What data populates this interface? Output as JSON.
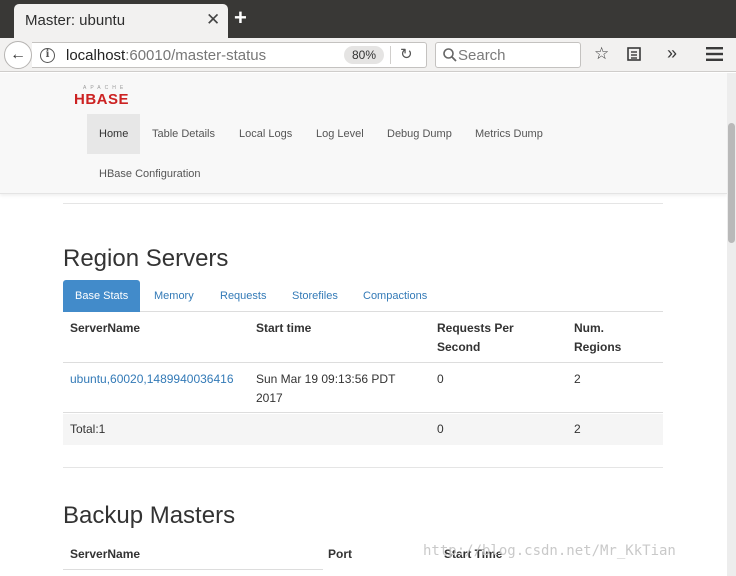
{
  "browser": {
    "tab_title": "Master: ubuntu",
    "tab_close": "✕",
    "new_tab": "+",
    "url_host": "localhost",
    "url_rest": ":60010/master-status",
    "zoom": "80%",
    "search_placeholder": "Search"
  },
  "hbase": {
    "logo_top": "APACHE",
    "logo_main": "HBASE",
    "nav": [
      "Home",
      "Table Details",
      "Local Logs",
      "Log Level",
      "Debug Dump",
      "Metrics Dump",
      "HBase Configuration"
    ]
  },
  "region_servers": {
    "title": "Region Servers",
    "tabs": [
      "Base Stats",
      "Memory",
      "Requests",
      "Storefiles",
      "Compactions"
    ],
    "headers": [
      "ServerName",
      "Start time",
      "Requests Per Second",
      "Num. Regions"
    ],
    "rows": [
      [
        "ubuntu,60020,1489940036416",
        "Sun Mar 19 09:13:56 PDT 2017",
        "0",
        "2"
      ]
    ],
    "total": [
      "Total:1",
      "",
      "0",
      "2"
    ]
  },
  "backup_masters": {
    "title": "Backup Masters",
    "headers": [
      "ServerName",
      "Port",
      "Start Time"
    ]
  },
  "watermark": "http://blog.csdn.net/Mr_KkTian",
  "colors": {
    "link": "#337ab7",
    "active_tab": "#428bca",
    "logo_red": "#cc2222",
    "tabbar": "#393836"
  }
}
